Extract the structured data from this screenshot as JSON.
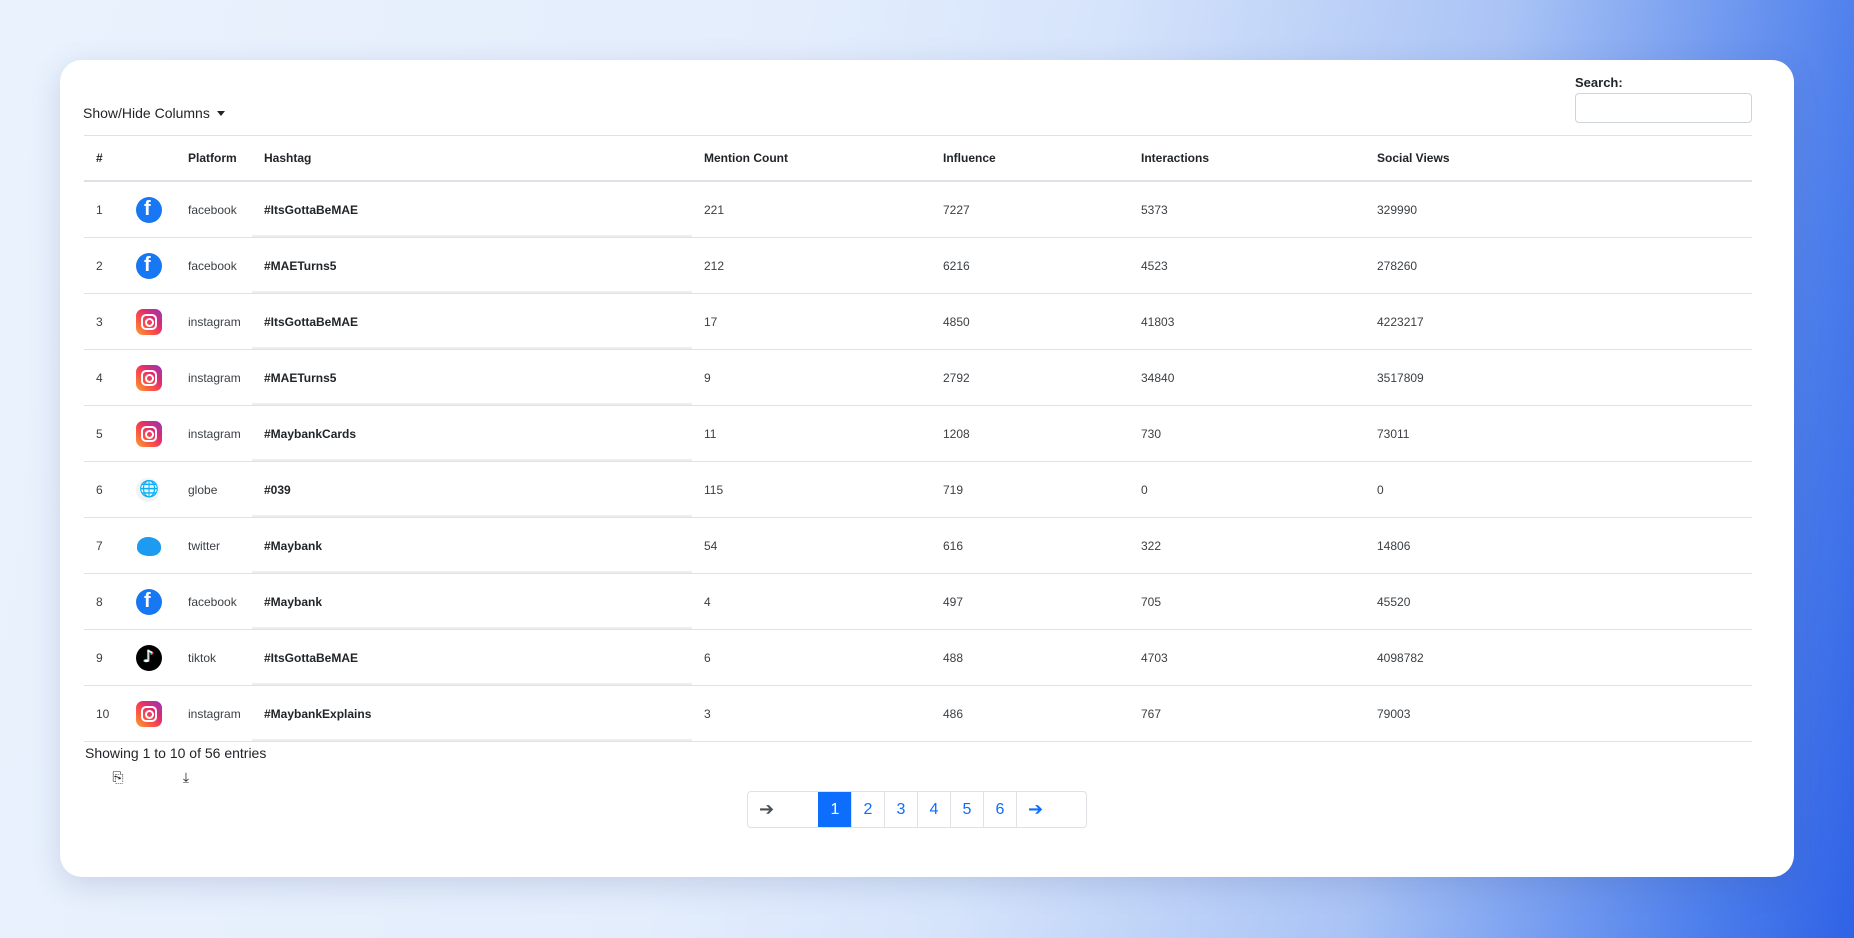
{
  "toolbar": {
    "columns_toggle_label": "Show/Hide Columns"
  },
  "search": {
    "label": "Search:",
    "value": "",
    "placeholder": ""
  },
  "table": {
    "headers": [
      "#",
      "",
      "Platform",
      "Hashtag",
      "Mention Count",
      "Influence",
      "Interactions",
      "Social Views"
    ],
    "rows": [
      {
        "num": "1",
        "icon": "facebook-icon",
        "platform": "facebook",
        "hashtag": "#ItsGottaBeMAE",
        "mentions": "221",
        "influence": "7227",
        "interactions": "5373",
        "views": "329990"
      },
      {
        "num": "2",
        "icon": "facebook-icon",
        "platform": "facebook",
        "hashtag": "#MAETurns5",
        "mentions": "212",
        "influence": "6216",
        "interactions": "4523",
        "views": "278260"
      },
      {
        "num": "3",
        "icon": "instagram-icon",
        "platform": "instagram",
        "hashtag": "#ItsGottaBeMAE",
        "mentions": "17",
        "influence": "4850",
        "interactions": "41803",
        "views": "4223217"
      },
      {
        "num": "4",
        "icon": "instagram-icon",
        "platform": "instagram",
        "hashtag": "#MAETurns5",
        "mentions": "9",
        "influence": "2792",
        "interactions": "34840",
        "views": "3517809"
      },
      {
        "num": "5",
        "icon": "instagram-icon",
        "platform": "instagram",
        "hashtag": "#MaybankCards",
        "mentions": "11",
        "influence": "1208",
        "interactions": "730",
        "views": "73011"
      },
      {
        "num": "6",
        "icon": "globe-icon",
        "platform": "globe",
        "hashtag": "#039",
        "mentions": "115",
        "influence": "719",
        "interactions": "0",
        "views": "0"
      },
      {
        "num": "7",
        "icon": "twitter-icon",
        "platform": "twitter",
        "hashtag": "#Maybank",
        "mentions": "54",
        "influence": "616",
        "interactions": "322",
        "views": "14806"
      },
      {
        "num": "8",
        "icon": "facebook-icon",
        "platform": "facebook",
        "hashtag": "#Maybank",
        "mentions": "4",
        "influence": "497",
        "interactions": "705",
        "views": "45520"
      },
      {
        "num": "9",
        "icon": "tiktok-icon",
        "platform": "tiktok",
        "hashtag": "#ItsGottaBeMAE",
        "mentions": "6",
        "influence": "488",
        "interactions": "4703",
        "views": "4098782"
      },
      {
        "num": "10",
        "icon": "instagram-icon",
        "platform": "instagram",
        "hashtag": "#MaybankExplains",
        "mentions": "3",
        "influence": "486",
        "interactions": "767",
        "views": "79003"
      }
    ]
  },
  "footer": {
    "info": "Showing 1 to 10 of 56 entries",
    "copy_icon": "copy-icon",
    "download_icon": "download-icon"
  },
  "pagination": {
    "prev_icon": "arrow-left-icon",
    "next_icon": "arrow-right-icon",
    "pages": [
      "1",
      "2",
      "3",
      "4",
      "5",
      "6"
    ],
    "active_page": "1"
  },
  "colors": {
    "accent": "#0d6efd",
    "facebook": "#1877f2",
    "twitter": "#1d9bf0",
    "tiktok": "#010101"
  }
}
